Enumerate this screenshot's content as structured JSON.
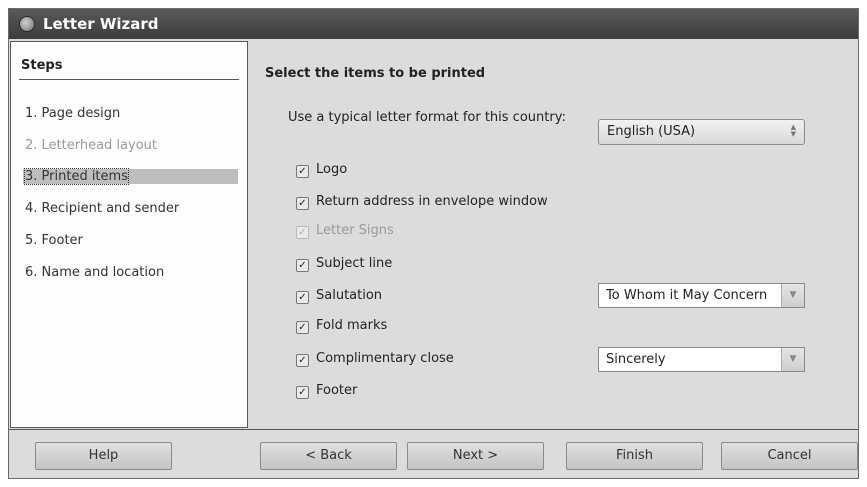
{
  "window": {
    "title": "Letter Wizard"
  },
  "steps": {
    "header": "Steps",
    "items": [
      {
        "label": "1. Page design"
      },
      {
        "label": "2. Letterhead layout"
      },
      {
        "label": "3. Printed items"
      },
      {
        "label": "4. Recipient and sender"
      },
      {
        "label": "5. Footer"
      },
      {
        "label": "6. Name and location"
      }
    ]
  },
  "main": {
    "title": "Select the items to be printed",
    "country_label": "Use a typical letter format for this country:",
    "country_value": "English (USA)",
    "checkboxes": [
      {
        "label": "Logo",
        "checked": true
      },
      {
        "label": "Return address in envelope window",
        "checked": true
      },
      {
        "label": "Letter Signs",
        "checked": true,
        "disabled": true
      },
      {
        "label": "Subject line",
        "checked": true
      },
      {
        "label": "Salutation",
        "checked": true
      },
      {
        "label": "Fold marks",
        "checked": true
      },
      {
        "label": "Complimentary close",
        "checked": true
      },
      {
        "label": "Footer",
        "checked": true
      }
    ],
    "salutation_value": "To Whom it May Concern",
    "complimentary_close_value": "Sincerely"
  },
  "buttons": {
    "help": "Help",
    "back": "< Back",
    "next": "Next >",
    "finish": "Finish",
    "cancel": "Cancel"
  }
}
